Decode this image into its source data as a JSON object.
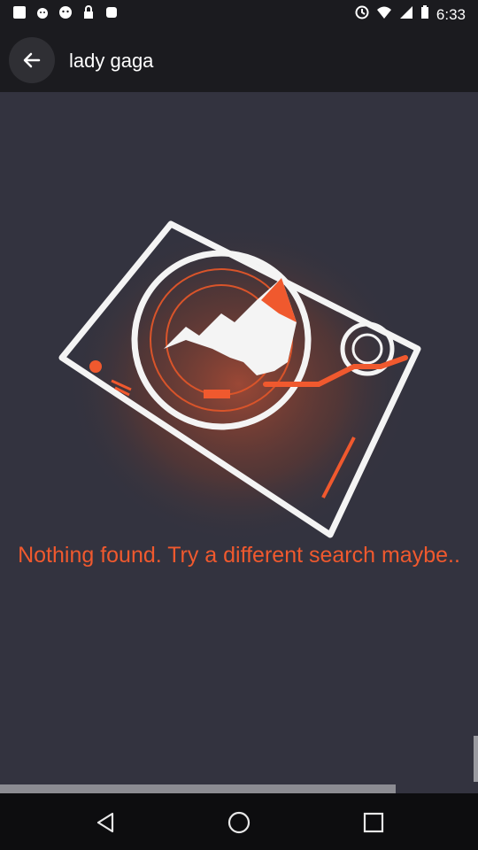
{
  "status_bar": {
    "time": "6:33",
    "icons": [
      "app-icon",
      "bug-icon",
      "face-icon",
      "lock-icon",
      "sim-icon"
    ],
    "right_icons": [
      "clock-icon",
      "wifi-icon",
      "signal-icon",
      "battery-icon"
    ]
  },
  "toolbar": {
    "title": "lady gaga",
    "back_icon": "arrow-left-icon"
  },
  "main": {
    "empty_message": "Nothing found. Try a different search maybe..",
    "illustration": "turntable-icon",
    "accent_color": "#f0592e"
  },
  "nav": {
    "back": "back-nav-icon",
    "home": "home-nav-icon",
    "recents": "recents-nav-icon"
  }
}
